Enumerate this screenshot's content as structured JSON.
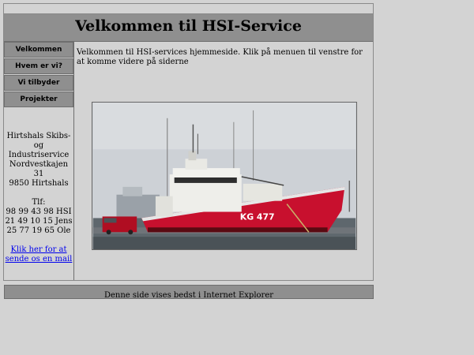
{
  "header": {
    "title": "Velkommen til HSI-Service"
  },
  "sidebar": {
    "nav": [
      {
        "label": "Velkommen"
      },
      {
        "label": "Hvem er vi?"
      },
      {
        "label": "Vi tilbyder"
      },
      {
        "label": "Projekter"
      }
    ],
    "contact": {
      "line1": "Hirtshals Skibs- og Industriservice",
      "line2": "Nordvestkajen 31",
      "line3": "9850 Hirtshals",
      "tlf_label": "Tlf:",
      "phone1": "98 99 43 98 HSI",
      "phone2": "21 49 10 15 Jens",
      "phone3": "25 77 19 65 Ole",
      "mail_link": "Klik her for at sende os en mail"
    }
  },
  "main": {
    "intro": "Velkommen til HSI-services hjemmeside. Klik på menuen til venstre for at komme videre på siderne",
    "photo": {
      "hull_marking": "KG 477"
    }
  },
  "footer": {
    "text": "Denne side vises bedst i Internet Explorer"
  },
  "colors": {
    "header_bg": "#8f8f8f",
    "page_bg": "#d3d3d3",
    "link": "#0000ee",
    "ship_hull": "#c8102e"
  }
}
